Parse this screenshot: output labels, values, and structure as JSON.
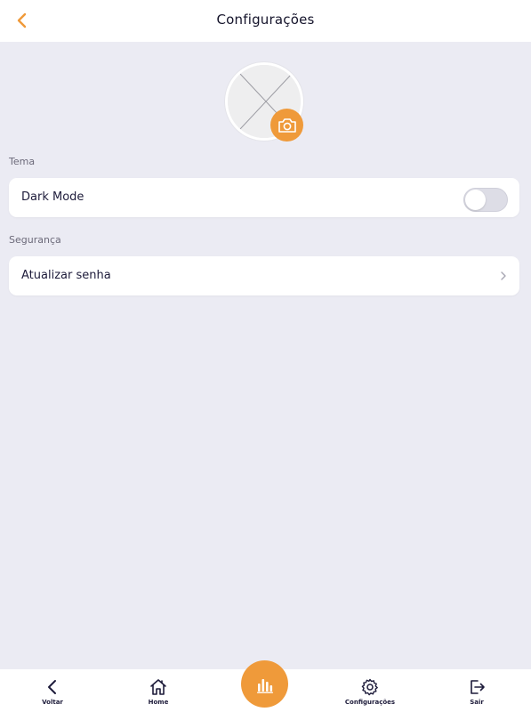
{
  "header": {
    "title": "Configurações",
    "back_icon": "chevron-left-icon",
    "accent_color": "#ef9a3a"
  },
  "profile": {
    "avatar_placeholder_icon": "image-placeholder-icon",
    "camera_icon": "camera-icon"
  },
  "sections": {
    "theme": {
      "label": "Tema",
      "dark_mode_label": "Dark Mode",
      "dark_mode_enabled": false
    },
    "security": {
      "label": "Segurança",
      "update_password_label": "Atualizar senha"
    }
  },
  "bottom_nav": {
    "items": [
      {
        "label": "Voltar",
        "icon": "chevron-left-icon"
      },
      {
        "label": "Home",
        "icon": "home-icon"
      },
      {
        "label": "Configurações",
        "icon": "gear-icon"
      },
      {
        "label": "Sair",
        "icon": "logout-icon"
      }
    ],
    "fab_icon": "bar-chart-icon"
  }
}
